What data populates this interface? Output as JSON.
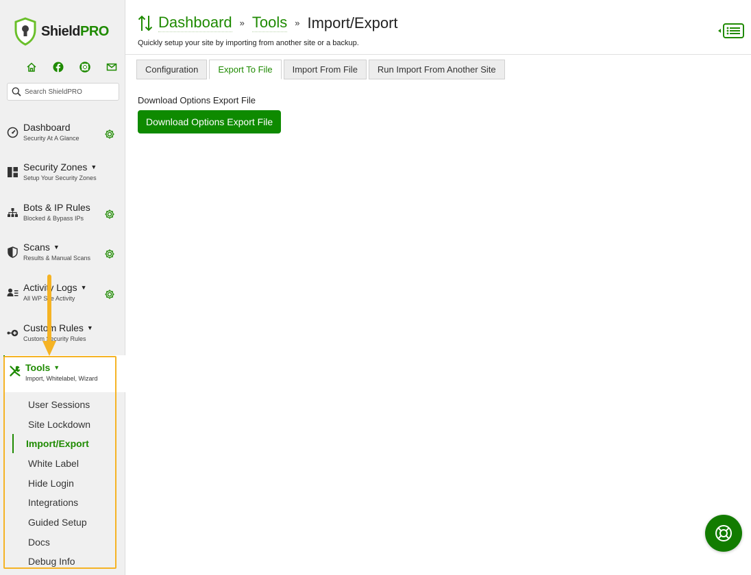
{
  "brand": {
    "name_part1": "Shield",
    "name_part2": "PRO",
    "accent": "#1e8a00"
  },
  "quick_icons": [
    "home-icon",
    "facebook-icon",
    "support-lifebuoy-icon",
    "email-icon"
  ],
  "search": {
    "placeholder": "Search ShieldPRO"
  },
  "nav": {
    "dashboard": {
      "title": "Dashboard",
      "subtitle": "Security At A Glance"
    },
    "security_zones": {
      "title": "Security Zones",
      "subtitle": "Setup Your Security Zones"
    },
    "bots": {
      "title": "Bots & IP Rules",
      "subtitle": "Blocked & Bypass IPs"
    },
    "scans": {
      "title": "Scans",
      "subtitle": "Results & Manual Scans"
    },
    "activity": {
      "title": "Activity Logs",
      "subtitle": "All WP Site Activity"
    },
    "custom_rules": {
      "title": "Custom Rules",
      "subtitle": "Custom Security Rules"
    },
    "tools": {
      "title": "Tools",
      "subtitle": "Import, Whitelabel, Wizard"
    },
    "caret": "▼"
  },
  "submenu": [
    "User Sessions",
    "Site Lockdown",
    "Import/Export",
    "White Label",
    "Hide Login",
    "Integrations",
    "Guided Setup",
    "Docs",
    "Debug Info"
  ],
  "header": {
    "breadcrumb": [
      "Dashboard",
      "Tools"
    ],
    "separator": "»",
    "current": "Import/Export",
    "subtitle": "Quickly setup your site by importing from another site or a backup."
  },
  "tabs": [
    "Configuration",
    "Export To File",
    "Import From File",
    "Run Import From Another Site"
  ],
  "active_tab": 1,
  "content": {
    "label": "Download Options Export File",
    "button": "Download Options Export File"
  }
}
